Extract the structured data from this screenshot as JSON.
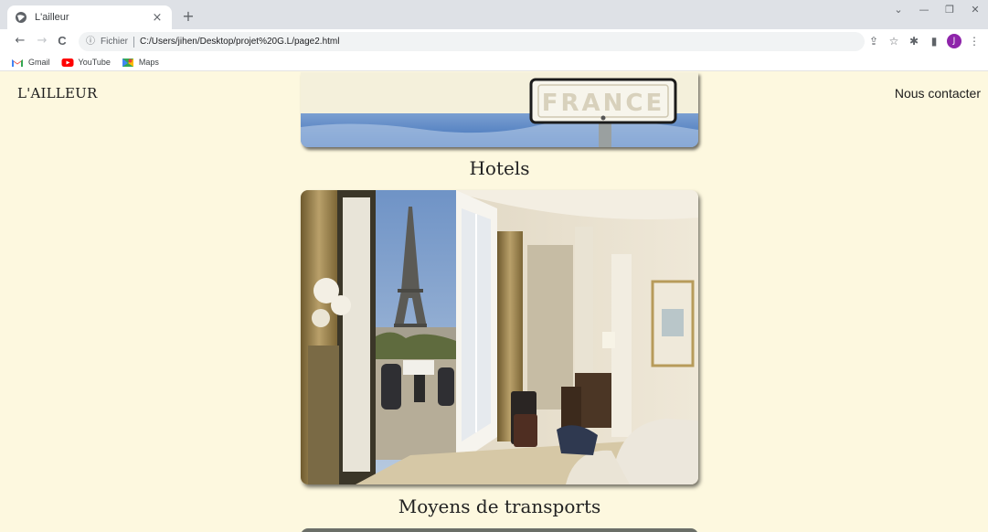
{
  "browser": {
    "tab_title": "L'ailleur",
    "tab_close": "×",
    "new_tab": "+",
    "back": "←",
    "forward": "→",
    "reload": "C",
    "info": "ⓘ",
    "url_scheme_label": "Fichier",
    "url": "C:/Users/jihen/Desktop/projet%20G.L/page2.html",
    "profile_initial": "J",
    "bookmarks": [
      {
        "label": "Gmail",
        "icon": "gmail-icon"
      },
      {
        "label": "YouTube",
        "icon": "youtube-icon"
      },
      {
        "label": "Maps",
        "icon": "maps-icon"
      }
    ]
  },
  "header": {
    "logo": "L'AILLEUR",
    "contact_link": "Nous contacter"
  },
  "sections": {
    "top_image_sign_text": "FRANCE",
    "hotels_title": "Hotels",
    "transport_title": "Moyens de transports"
  }
}
